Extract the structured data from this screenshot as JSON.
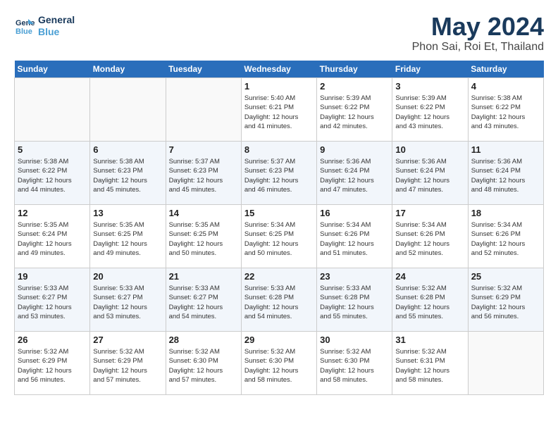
{
  "header": {
    "logo_line1": "General",
    "logo_line2": "Blue",
    "month": "May 2024",
    "location": "Phon Sai, Roi Et, Thailand"
  },
  "days_of_week": [
    "Sunday",
    "Monday",
    "Tuesday",
    "Wednesday",
    "Thursday",
    "Friday",
    "Saturday"
  ],
  "weeks": [
    [
      {
        "day": "",
        "info": ""
      },
      {
        "day": "",
        "info": ""
      },
      {
        "day": "",
        "info": ""
      },
      {
        "day": "1",
        "info": "Sunrise: 5:40 AM\nSunset: 6:21 PM\nDaylight: 12 hours\nand 41 minutes."
      },
      {
        "day": "2",
        "info": "Sunrise: 5:39 AM\nSunset: 6:22 PM\nDaylight: 12 hours\nand 42 minutes."
      },
      {
        "day": "3",
        "info": "Sunrise: 5:39 AM\nSunset: 6:22 PM\nDaylight: 12 hours\nand 43 minutes."
      },
      {
        "day": "4",
        "info": "Sunrise: 5:38 AM\nSunset: 6:22 PM\nDaylight: 12 hours\nand 43 minutes."
      }
    ],
    [
      {
        "day": "5",
        "info": "Sunrise: 5:38 AM\nSunset: 6:22 PM\nDaylight: 12 hours\nand 44 minutes."
      },
      {
        "day": "6",
        "info": "Sunrise: 5:38 AM\nSunset: 6:23 PM\nDaylight: 12 hours\nand 45 minutes."
      },
      {
        "day": "7",
        "info": "Sunrise: 5:37 AM\nSunset: 6:23 PM\nDaylight: 12 hours\nand 45 minutes."
      },
      {
        "day": "8",
        "info": "Sunrise: 5:37 AM\nSunset: 6:23 PM\nDaylight: 12 hours\nand 46 minutes."
      },
      {
        "day": "9",
        "info": "Sunrise: 5:36 AM\nSunset: 6:24 PM\nDaylight: 12 hours\nand 47 minutes."
      },
      {
        "day": "10",
        "info": "Sunrise: 5:36 AM\nSunset: 6:24 PM\nDaylight: 12 hours\nand 47 minutes."
      },
      {
        "day": "11",
        "info": "Sunrise: 5:36 AM\nSunset: 6:24 PM\nDaylight: 12 hours\nand 48 minutes."
      }
    ],
    [
      {
        "day": "12",
        "info": "Sunrise: 5:35 AM\nSunset: 6:24 PM\nDaylight: 12 hours\nand 49 minutes."
      },
      {
        "day": "13",
        "info": "Sunrise: 5:35 AM\nSunset: 6:25 PM\nDaylight: 12 hours\nand 49 minutes."
      },
      {
        "day": "14",
        "info": "Sunrise: 5:35 AM\nSunset: 6:25 PM\nDaylight: 12 hours\nand 50 minutes."
      },
      {
        "day": "15",
        "info": "Sunrise: 5:34 AM\nSunset: 6:25 PM\nDaylight: 12 hours\nand 50 minutes."
      },
      {
        "day": "16",
        "info": "Sunrise: 5:34 AM\nSunset: 6:26 PM\nDaylight: 12 hours\nand 51 minutes."
      },
      {
        "day": "17",
        "info": "Sunrise: 5:34 AM\nSunset: 6:26 PM\nDaylight: 12 hours\nand 52 minutes."
      },
      {
        "day": "18",
        "info": "Sunrise: 5:34 AM\nSunset: 6:26 PM\nDaylight: 12 hours\nand 52 minutes."
      }
    ],
    [
      {
        "day": "19",
        "info": "Sunrise: 5:33 AM\nSunset: 6:27 PM\nDaylight: 12 hours\nand 53 minutes."
      },
      {
        "day": "20",
        "info": "Sunrise: 5:33 AM\nSunset: 6:27 PM\nDaylight: 12 hours\nand 53 minutes."
      },
      {
        "day": "21",
        "info": "Sunrise: 5:33 AM\nSunset: 6:27 PM\nDaylight: 12 hours\nand 54 minutes."
      },
      {
        "day": "22",
        "info": "Sunrise: 5:33 AM\nSunset: 6:28 PM\nDaylight: 12 hours\nand 54 minutes."
      },
      {
        "day": "23",
        "info": "Sunrise: 5:33 AM\nSunset: 6:28 PM\nDaylight: 12 hours\nand 55 minutes."
      },
      {
        "day": "24",
        "info": "Sunrise: 5:32 AM\nSunset: 6:28 PM\nDaylight: 12 hours\nand 55 minutes."
      },
      {
        "day": "25",
        "info": "Sunrise: 5:32 AM\nSunset: 6:29 PM\nDaylight: 12 hours\nand 56 minutes."
      }
    ],
    [
      {
        "day": "26",
        "info": "Sunrise: 5:32 AM\nSunset: 6:29 PM\nDaylight: 12 hours\nand 56 minutes."
      },
      {
        "day": "27",
        "info": "Sunrise: 5:32 AM\nSunset: 6:29 PM\nDaylight: 12 hours\nand 57 minutes."
      },
      {
        "day": "28",
        "info": "Sunrise: 5:32 AM\nSunset: 6:30 PM\nDaylight: 12 hours\nand 57 minutes."
      },
      {
        "day": "29",
        "info": "Sunrise: 5:32 AM\nSunset: 6:30 PM\nDaylight: 12 hours\nand 58 minutes."
      },
      {
        "day": "30",
        "info": "Sunrise: 5:32 AM\nSunset: 6:30 PM\nDaylight: 12 hours\nand 58 minutes."
      },
      {
        "day": "31",
        "info": "Sunrise: 5:32 AM\nSunset: 6:31 PM\nDaylight: 12 hours\nand 58 minutes."
      },
      {
        "day": "",
        "info": ""
      }
    ]
  ]
}
